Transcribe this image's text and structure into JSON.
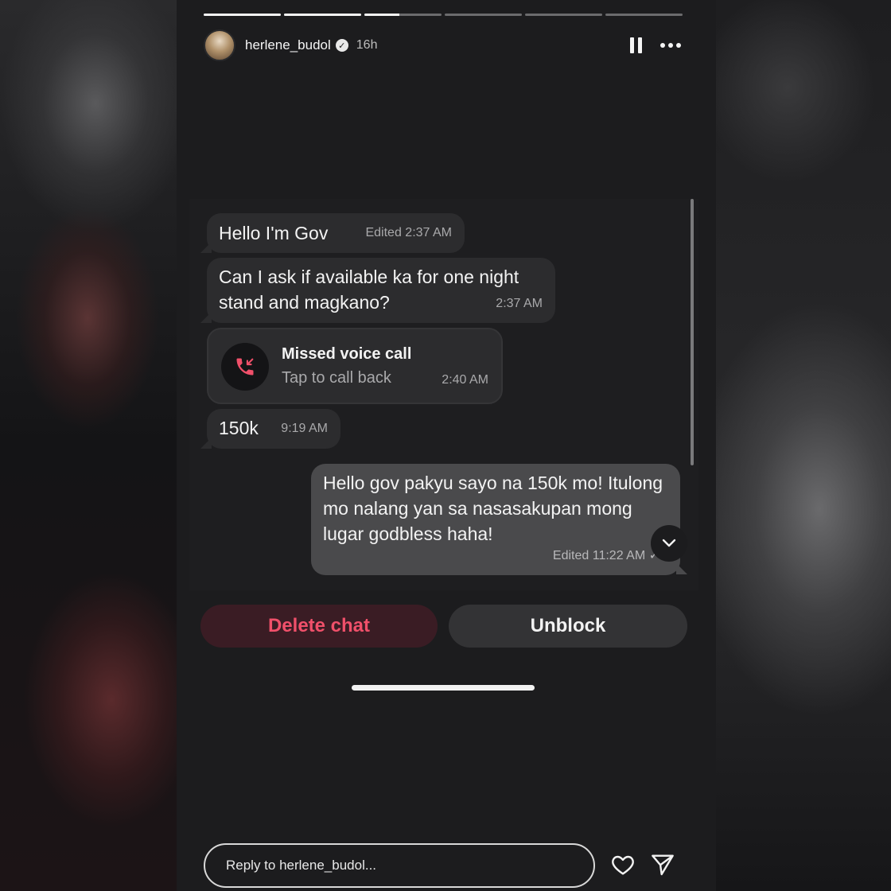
{
  "story": {
    "username": "herlene_budol",
    "verified_mark": "✓",
    "time_ago": "16h",
    "progress_segments": [
      1.0,
      1.0,
      0.45,
      0.0,
      0.0,
      0.0
    ],
    "icons": [
      "pause-icon",
      "more-icon"
    ]
  },
  "chat": {
    "messages": [
      {
        "text": "Hello I'm Gov",
        "time": "Edited 2:37 AM",
        "side": "left"
      },
      {
        "text": "Can I ask if available ka for one night stand and magkano?",
        "time": "2:37 AM",
        "side": "left"
      },
      {
        "title": "Missed voice call",
        "subtitle": "Tap to call back",
        "time": "2:40 AM",
        "side": "left",
        "icon": "missed-call-icon"
      },
      {
        "text": "150k",
        "time": "9:19 AM",
        "side": "left"
      },
      {
        "text": "Hello gov pakyu sayo na 150k mo! Itulong mo nalang yan sa nasasakupan mong lugar godbless haha!",
        "time": "Edited 11:22 AM ✓",
        "side": "right"
      }
    ]
  },
  "actions": {
    "delete_label": "Delete chat",
    "unblock_label": "Unblock"
  },
  "reply": {
    "placeholder": "Reply to herlene_budol..."
  },
  "colors": {
    "delete_text": "#f0506a",
    "delete_bg": "#3a1c24",
    "missed_call_icon": "#f0506a"
  }
}
